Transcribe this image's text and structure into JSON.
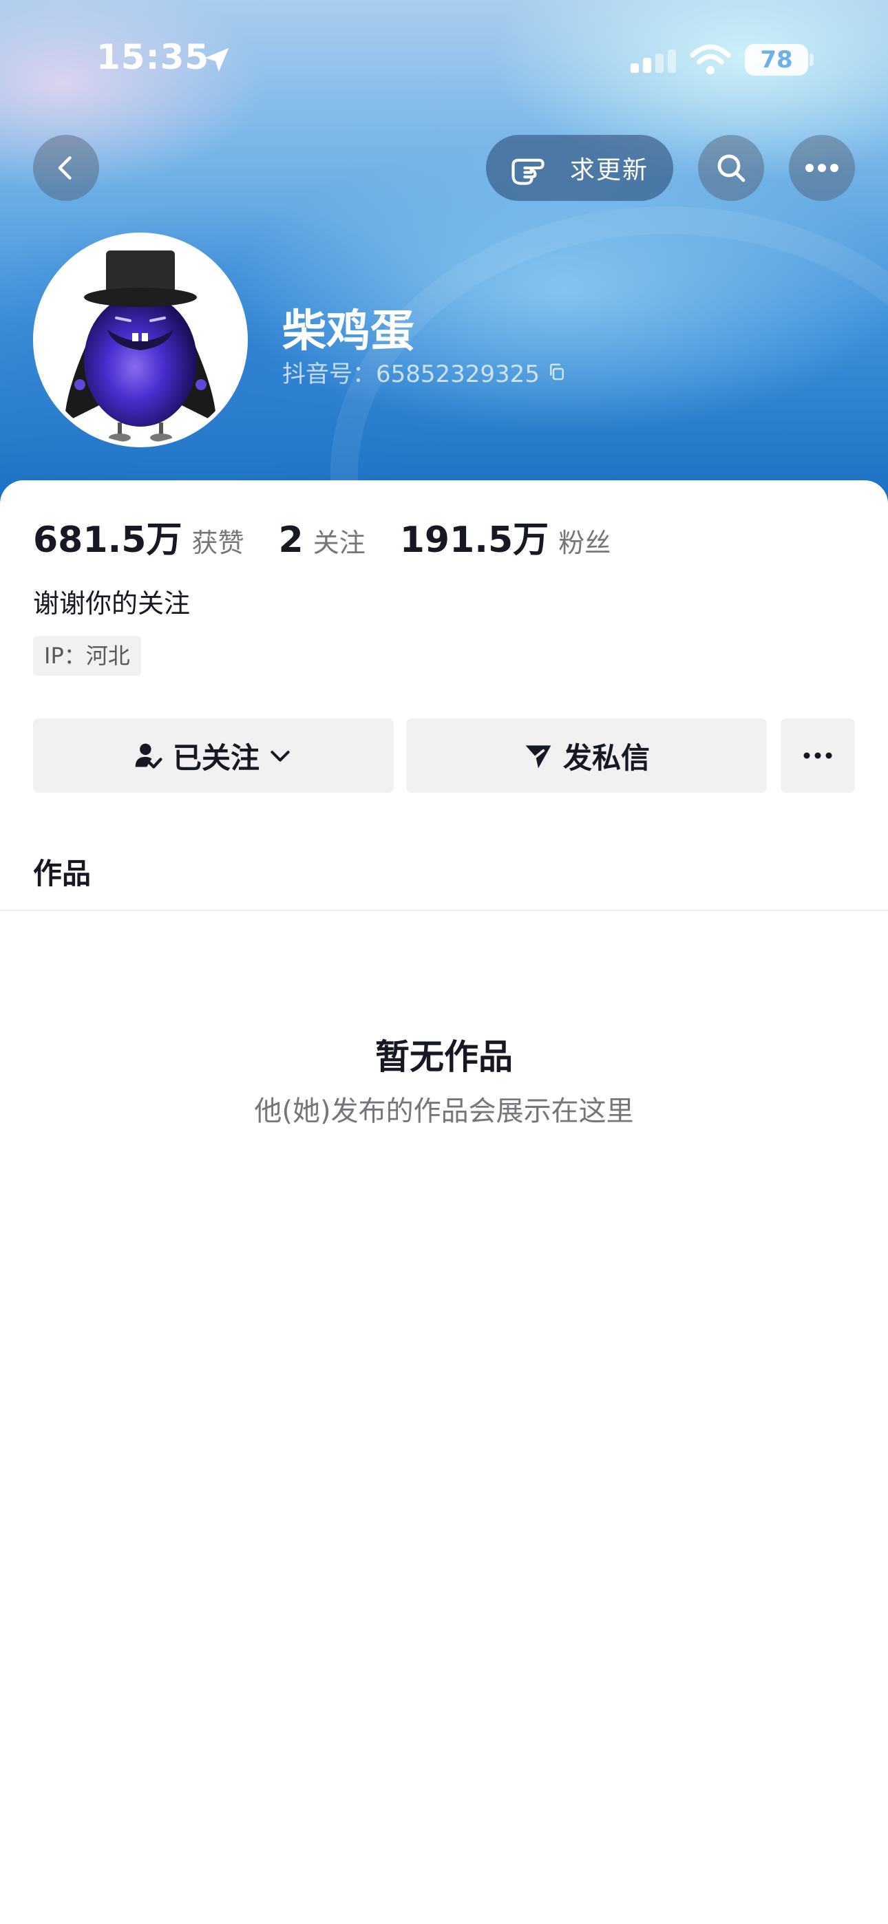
{
  "status_bar": {
    "time": "15:35",
    "battery": "78",
    "icons": [
      "location-arrow-icon",
      "signal-icon",
      "wifi-icon",
      "battery-icon"
    ]
  },
  "top_bar": {
    "back_icon": "chevron-left-icon",
    "update_label": "求更新",
    "update_icon": "pointing-hand-icon",
    "search_icon": "search-icon",
    "more_icon": "more-dots-icon"
  },
  "profile": {
    "nickname": "柴鸡蛋",
    "douyin_id": "抖音号：65852329325",
    "copy_icon": "copy-icon"
  },
  "stats": [
    {
      "value": "681.5万",
      "label": "获赞"
    },
    {
      "value": "2",
      "label": "关注"
    },
    {
      "value": "191.5万",
      "label": "粉丝"
    }
  ],
  "bio": "谢谢你的关注",
  "ip": "IP：河北",
  "actions": {
    "follow_label": "已关注",
    "message_label": "发私信"
  },
  "tabs": {
    "works_label": "作品"
  },
  "empty_state": {
    "title": "暂无作品",
    "subtitle": "他(她)发布的作品会展示在这里"
  },
  "colors": {
    "header_blue": "#3d8fd9",
    "text_primary": "#161823",
    "text_secondary": "#75767c",
    "button_bg": "#f1f1f2"
  }
}
